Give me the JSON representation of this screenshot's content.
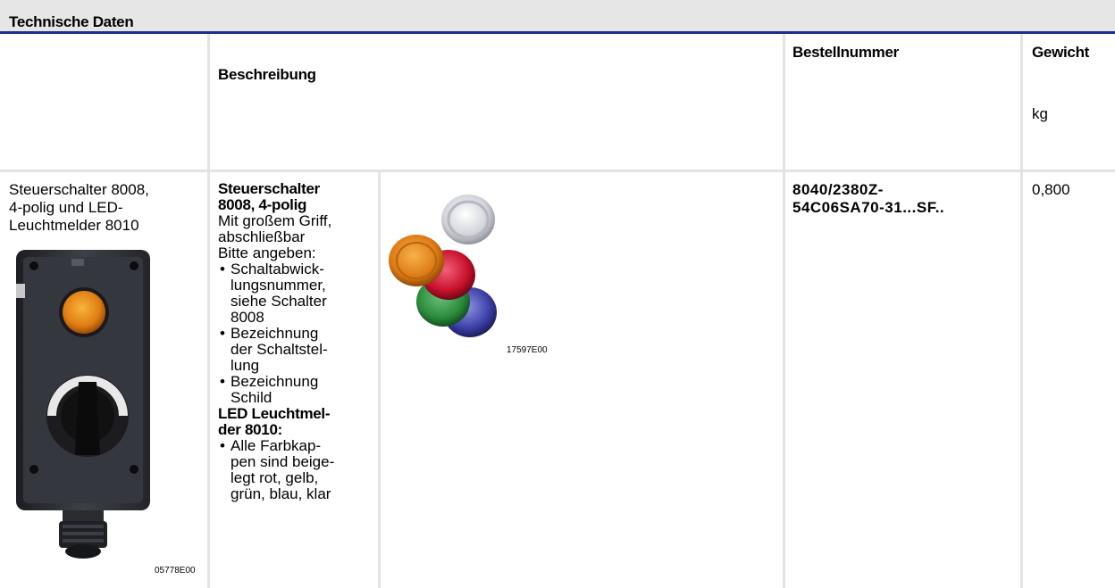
{
  "section_title": "Technische Daten",
  "header": {
    "beschreibung": "Beschreibung",
    "bestellnummer": "Bestellnummer",
    "gewicht": "Gewicht",
    "gewicht_unit": "kg"
  },
  "row": {
    "product_name_lines": [
      "Steuerschalter 8008,",
      "4-polig und LED-",
      "Leuchtmelder 8010"
    ],
    "product_image_caption": "05778E00",
    "lamp_image_caption": "17597E00",
    "description": {
      "title_lines": [
        "Steuerschalter",
        "8008, 4-polig"
      ],
      "lines": [
        "Mit großem Griff,",
        "abschließbar",
        "Bitte angeben:"
      ],
      "bullets1": [
        [
          "Schaltabwick-",
          "lungsnummer,",
          "siehe Schalter",
          "8008"
        ],
        [
          "Bezeichnung",
          "der Schaltstel-",
          "lung"
        ],
        [
          "Bezeichnung",
          "Schild"
        ]
      ],
      "subtitle_lines": [
        "LED Leuchtmel-",
        "der 8010:"
      ],
      "bullets2": [
        [
          "Alle Farbkap-",
          "pen sind beige-",
          "legt rot, gelb,",
          "grün, blau, klar"
        ]
      ]
    },
    "order_number_lines": [
      "8040/2380Z-",
      "54C06SA70-31...SF.."
    ],
    "weight": "0,800"
  }
}
